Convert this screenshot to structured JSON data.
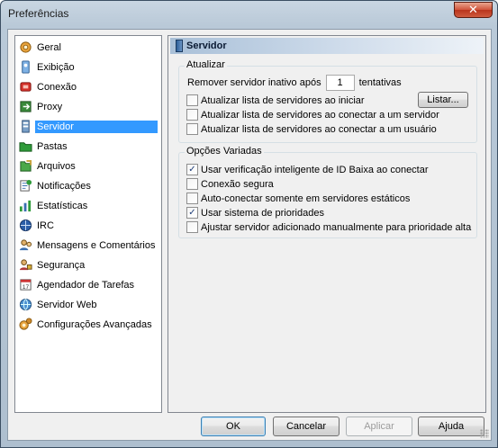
{
  "window": {
    "title": "Preferências",
    "close_label": "✕"
  },
  "tree": {
    "items": [
      {
        "label": "Geral",
        "icon": "gear-icon",
        "selected": false
      },
      {
        "label": "Exibição",
        "icon": "display-icon",
        "selected": false
      },
      {
        "label": "Conexão",
        "icon": "connection-icon",
        "selected": false
      },
      {
        "label": "Proxy",
        "icon": "proxy-icon",
        "selected": false
      },
      {
        "label": "Servidor",
        "icon": "server-icon",
        "selected": true
      },
      {
        "label": "Pastas",
        "icon": "folder-icon",
        "selected": false
      },
      {
        "label": "Arquivos",
        "icon": "files-icon",
        "selected": false
      },
      {
        "label": "Notificações",
        "icon": "notification-icon",
        "selected": false
      },
      {
        "label": "Estatísticas",
        "icon": "statistics-icon",
        "selected": false
      },
      {
        "label": "IRC",
        "icon": "irc-icon",
        "selected": false
      },
      {
        "label": "Mensagens e Comentários",
        "icon": "messages-icon",
        "selected": false
      },
      {
        "label": "Segurança",
        "icon": "security-icon",
        "selected": false
      },
      {
        "label": "Agendador de Tarefas",
        "icon": "scheduler-icon",
        "selected": false
      },
      {
        "label": "Servidor Web",
        "icon": "web-server-icon",
        "selected": false
      },
      {
        "label": "Configurações Avançadas",
        "icon": "advanced-settings-icon",
        "selected": false
      }
    ]
  },
  "panel": {
    "title": "Servidor",
    "update_group": {
      "title": "Atualizar",
      "remove_prefix": "Remover servidor inativo após",
      "remove_value": "1",
      "remove_suffix": "tentativas",
      "list_button": "Listar...",
      "options": [
        {
          "label": "Atualizar lista de servidores ao iniciar",
          "checked": false
        },
        {
          "label": "Atualizar lista de servidores ao conectar a um servidor",
          "checked": false
        },
        {
          "label": "Atualizar lista de servidores ao conectar a um usuário",
          "checked": false
        }
      ]
    },
    "misc_group": {
      "title": "Opções Variadas",
      "options": [
        {
          "label": "Usar verificação inteligente de ID Baixa ao conectar",
          "checked": true
        },
        {
          "label": "Conexão segura",
          "checked": false
        },
        {
          "label": "Auto-conectar somente em servidores estáticos",
          "checked": false
        },
        {
          "label": "Usar sistema de prioridades",
          "checked": true
        },
        {
          "label": "Ajustar servidor adicionado manualmente para prioridade alta",
          "checked": false
        }
      ]
    }
  },
  "buttons": {
    "ok": "OK",
    "cancel": "Cancelar",
    "apply": "Aplicar",
    "help": "Ajuda"
  },
  "colors": {
    "selection": "#3399ff",
    "header_gradient_start": "#a9c0d8"
  }
}
